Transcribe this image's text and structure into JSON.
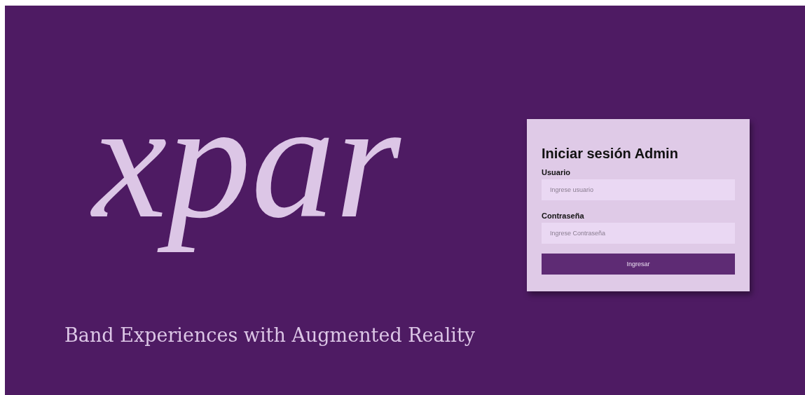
{
  "brand": {
    "logo": "xpar",
    "tagline": "Band Experiences with Augmented Reality"
  },
  "login": {
    "title": "Iniciar sesión Admin",
    "fields": [
      {
        "label": "Usuario",
        "placeholder": "Ingrese usuario"
      },
      {
        "label": "Contraseña",
        "placeholder": "Ingrese Contraseña"
      }
    ],
    "submit": "Ingresar"
  }
}
